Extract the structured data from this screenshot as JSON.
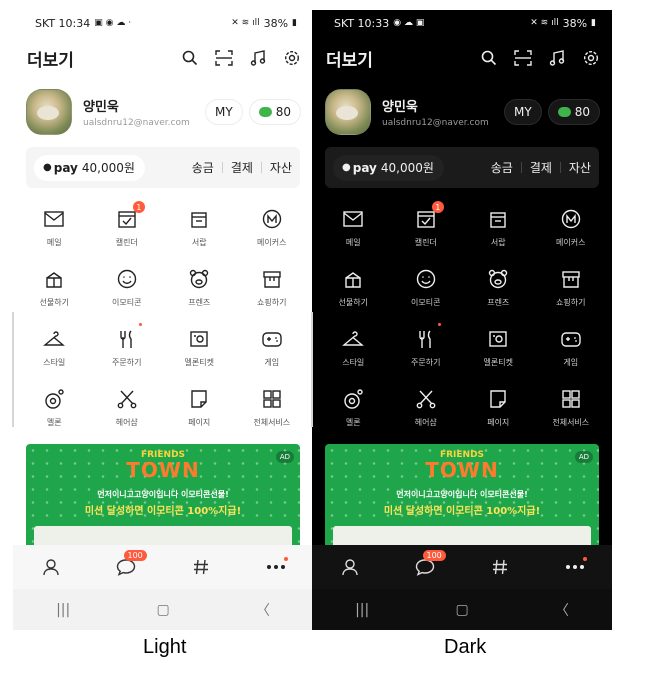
{
  "captions": {
    "light": "Light",
    "dark": "Dark"
  },
  "status": {
    "light": {
      "carrier_time": "SKT 10:34",
      "battery": "38%"
    },
    "dark": {
      "carrier_time": "SKT 10:33",
      "battery": "38%"
    }
  },
  "header": {
    "title": "더보기"
  },
  "profile": {
    "name": "양민욱",
    "email": "ualsdnru12@naver.com",
    "my_label": "MY",
    "points": "80"
  },
  "pay": {
    "pay_label": "pay",
    "amount": "40,000원",
    "links": [
      "송금",
      "결제",
      "자산"
    ]
  },
  "menu": [
    {
      "label": "메일",
      "icon": "mail-icon"
    },
    {
      "label": "캘린더",
      "icon": "calendar-icon",
      "badge": "1"
    },
    {
      "label": "서랍",
      "icon": "drawer-icon"
    },
    {
      "label": "메이커스",
      "icon": "makers-icon"
    },
    {
      "label": "선물하기",
      "icon": "gift-icon"
    },
    {
      "label": "이모티콘",
      "icon": "emoticon-icon"
    },
    {
      "label": "프렌즈",
      "icon": "friends-icon"
    },
    {
      "label": "쇼핑하기",
      "icon": "shopping-icon"
    },
    {
      "label": "스타일",
      "icon": "hanger-icon"
    },
    {
      "label": "주문하기",
      "icon": "fork-knife-icon",
      "dot": true
    },
    {
      "label": "멜론티켓",
      "icon": "ticket-icon"
    },
    {
      "label": "게임",
      "icon": "game-icon"
    },
    {
      "label": "멜론",
      "icon": "melon-icon"
    },
    {
      "label": "헤어샵",
      "icon": "scissors-icon"
    },
    {
      "label": "페이지",
      "icon": "page-icon"
    },
    {
      "label": "전체서비스",
      "icon": "grid-icon"
    }
  ],
  "banner": {
    "ad": "AD",
    "logo_top": "FRIENDS",
    "logo_main": "TOWN",
    "line1": "먼저이니고고양이입니다 이모티콘선물!",
    "line2": "미션 달성하면 이모티콘 100%지급!"
  },
  "bottomnav": {
    "chat_badge": "100"
  },
  "colors": {
    "accent_badge": "#ff5a3c",
    "banner_green": "#1fa64a",
    "coin_green": "#3db54a"
  }
}
